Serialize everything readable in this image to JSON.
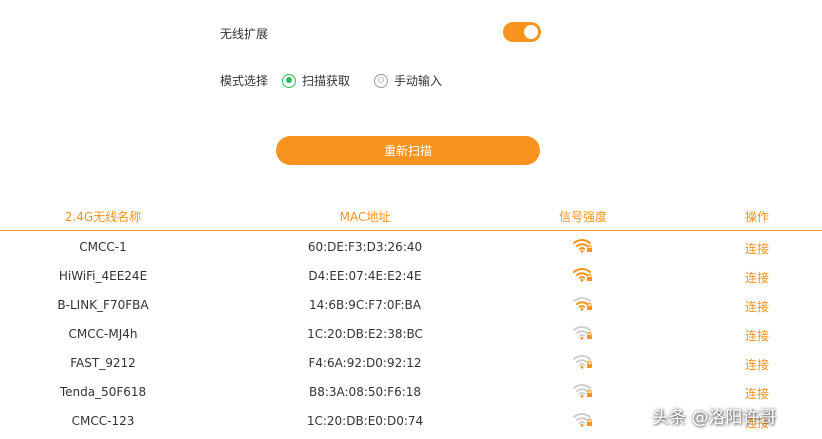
{
  "settings": {
    "wireless_extension_label": "无线扩展",
    "wireless_extension_on": true,
    "mode_label": "模式选择",
    "mode_options": [
      {
        "label": "扫描获取",
        "checked": true
      },
      {
        "label": "手动输入",
        "checked": false
      }
    ],
    "rescan_label": "重新扫描"
  },
  "table": {
    "headers": [
      "2.4G无线名称",
      "MAC地址",
      "信号强度",
      "操作"
    ],
    "rows": [
      {
        "ssid": "CMCC-1",
        "mac": "60:DE:F3:D3:26:40",
        "signal": 4,
        "action": "连接"
      },
      {
        "ssid": "HiWiFi_4EE24E",
        "mac": "D4:EE:07:4E:E2:4E",
        "signal": 4,
        "action": "连接"
      },
      {
        "ssid": "B-LINK_F70FBA",
        "mac": "14:6B:9C:F7:0F:BA",
        "signal": 3,
        "action": "连接"
      },
      {
        "ssid": "CMCC-MJ4h",
        "mac": "1C:20:DB:E2:38:BC",
        "signal": 1,
        "action": "连接"
      },
      {
        "ssid": "FAST_9212",
        "mac": "F4:6A:92:D0:92:12",
        "signal": 1,
        "action": "连接"
      },
      {
        "ssid": "Tenda_50F618",
        "mac": "B8:3A:08:50:F6:18",
        "signal": 1,
        "action": "连接"
      },
      {
        "ssid": "CMCC-123",
        "mac": "1C:20:DB:E0:D0:74",
        "signal": 1,
        "action": "连接"
      }
    ]
  },
  "watermark": "头条 @洛阳许哥",
  "colors": {
    "accent": "#f7931e",
    "radio_checked": "#2ebd59",
    "signal_inactive": "#cfcfcf"
  },
  "icons": {
    "signal": "wifi-signal-icon",
    "lock": "lock-icon"
  }
}
